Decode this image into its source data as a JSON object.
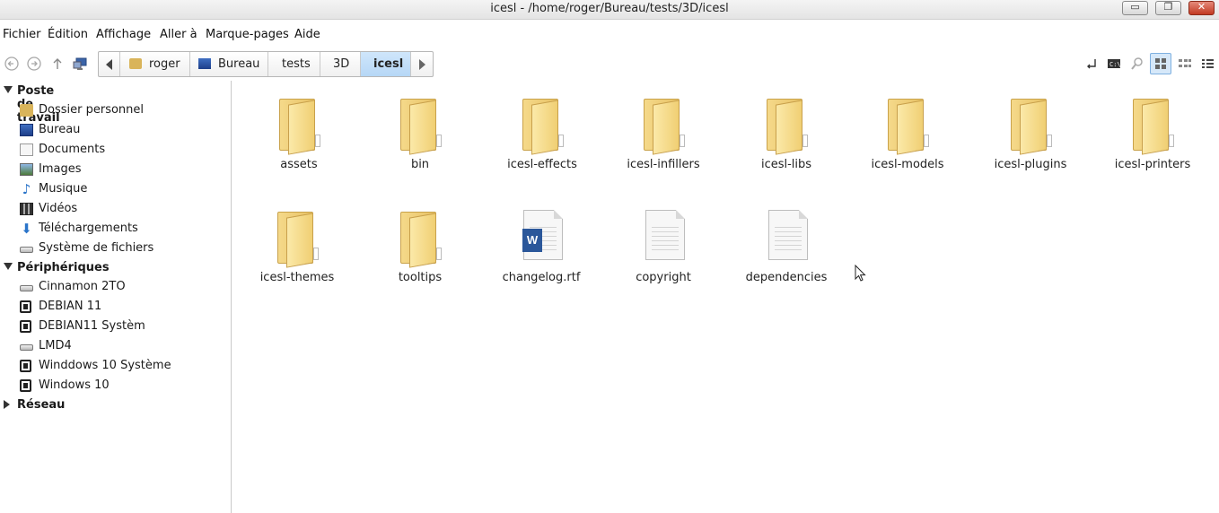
{
  "window": {
    "title": "icesl - /home/roger/Bureau/tests/3D/icesl",
    "controls": {
      "minimize": "▭",
      "maximize": "❐",
      "close": "✕"
    }
  },
  "menubar": [
    "Fichier",
    "Édition",
    "Affichage",
    "Aller à",
    "Marque-pages",
    "Aide"
  ],
  "toolbar": {
    "nav_icons": [
      "back-icon",
      "forward-icon",
      "up-icon",
      "computer-icon"
    ],
    "breadcrumbs": [
      "roger",
      "Bureau",
      "tests",
      "3D",
      "icesl"
    ],
    "active_crumb": "icesl",
    "right_icons": [
      "open-terminal-icon",
      "terminal-icon",
      "search-icon",
      "icon-view-icon",
      "compact-view-icon",
      "detail-view-icon"
    ]
  },
  "sidebar": {
    "sections": [
      {
        "label": "Poste de travail",
        "expanded": true,
        "items": [
          {
            "label": "Dossier personnel",
            "icon": "home-folder-icon"
          },
          {
            "label": "Bureau",
            "icon": "desktop-icon"
          },
          {
            "label": "Documents",
            "icon": "documents-icon"
          },
          {
            "label": "Images",
            "icon": "images-icon"
          },
          {
            "label": "Musique",
            "icon": "music-icon"
          },
          {
            "label": "Vidéos",
            "icon": "videos-icon"
          },
          {
            "label": "Téléchargements",
            "icon": "downloads-icon"
          },
          {
            "label": "Système de fichiers",
            "icon": "drive-icon"
          }
        ]
      },
      {
        "label": "Périphériques",
        "expanded": true,
        "items": [
          {
            "label": "Cinnamon 2TO",
            "icon": "drive-icon"
          },
          {
            "label": "DEBIAN 11",
            "icon": "chip-icon"
          },
          {
            "label": "DEBIAN11 Systèm",
            "icon": "chip-icon"
          },
          {
            "label": "LMD4",
            "icon": "drive-icon"
          },
          {
            "label": "Winddows 10 Système",
            "icon": "chip-icon"
          },
          {
            "label": "Windows 10",
            "icon": "chip-icon"
          }
        ]
      },
      {
        "label": "Réseau",
        "expanded": false,
        "items": []
      }
    ]
  },
  "files": [
    {
      "name": "assets",
      "type": "folder"
    },
    {
      "name": "bin",
      "type": "folder"
    },
    {
      "name": "icesl-effects",
      "type": "folder"
    },
    {
      "name": "icesl-infillers",
      "type": "folder"
    },
    {
      "name": "icesl-libs",
      "type": "folder"
    },
    {
      "name": "icesl-models",
      "type": "folder"
    },
    {
      "name": "icesl-plugins",
      "type": "folder"
    },
    {
      "name": "icesl-printers",
      "type": "folder"
    },
    {
      "name": "icesl-themes",
      "type": "folder"
    },
    {
      "name": "tooltips",
      "type": "folder"
    },
    {
      "name": "changelog.rtf",
      "type": "word-document"
    },
    {
      "name": "copyright",
      "type": "text-file"
    },
    {
      "name": "dependencies",
      "type": "text-file"
    }
  ],
  "colors": {
    "active_crumb": "#b6d7f6",
    "folder": "#f0cf73",
    "word": "#2b579a"
  }
}
